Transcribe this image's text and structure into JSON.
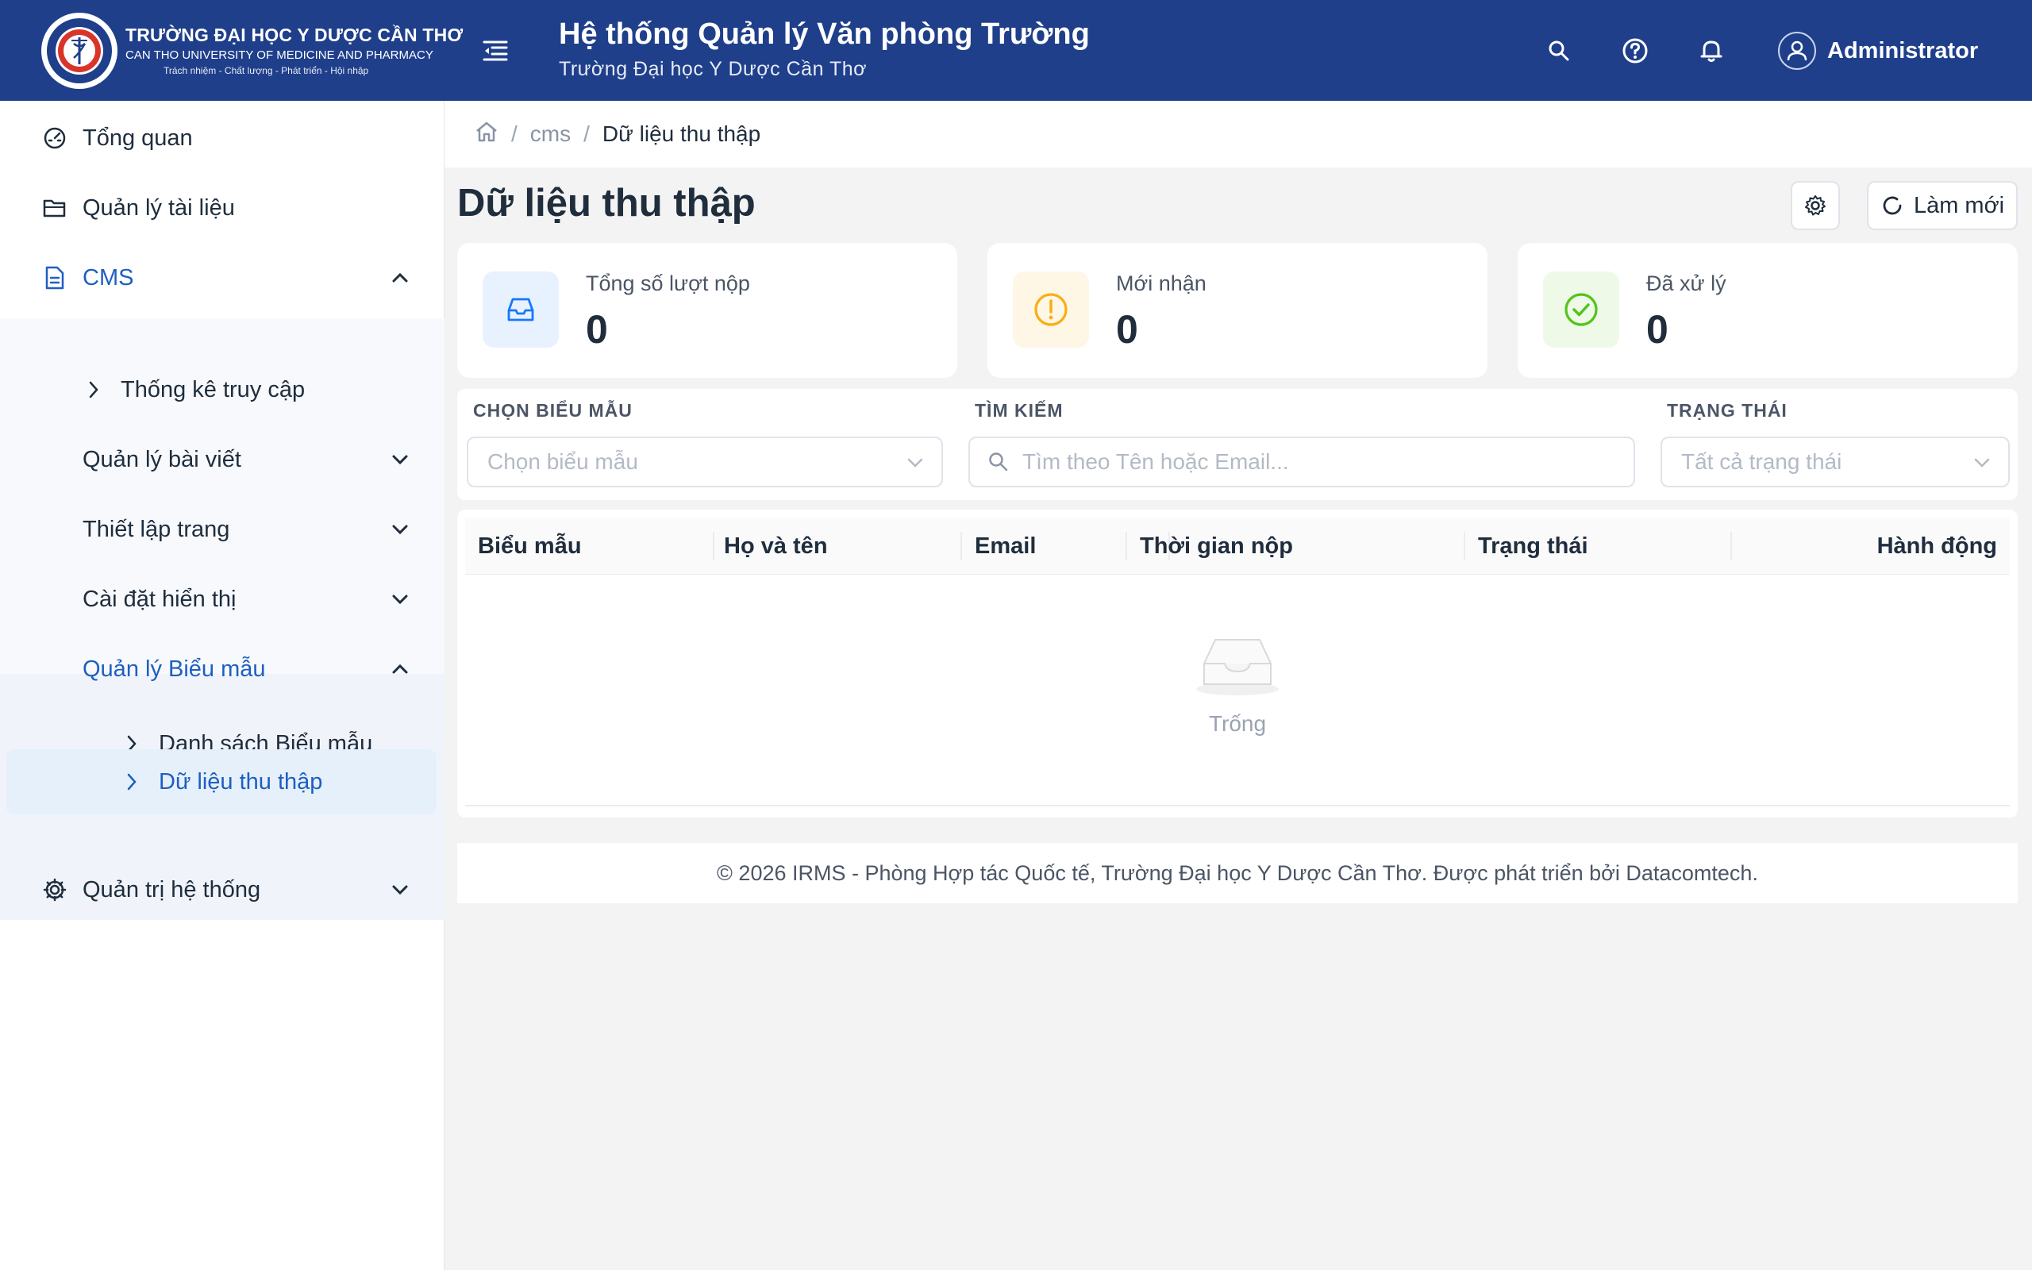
{
  "header": {
    "logo": {
      "line1": "TRƯỜNG ĐẠI HỌC Y DƯỢC CẦN THƠ",
      "line2": "CAN THO UNIVERSITY OF MEDICINE AND PHARMACY",
      "line3": "Trách nhiệm - Chất lượng - Phát triển - Hội nhập"
    },
    "title": "Hệ thống Quản lý Văn phòng Trường",
    "subtitle": "Trường Đại học Y Dược Cần Thơ",
    "icons": [
      "search-icon",
      "help-icon",
      "bell-icon"
    ],
    "user": "Administrator",
    "color": "#1f3f8b"
  },
  "sidebar": {
    "items": [
      {
        "label": "Tổng quan",
        "icon": "dashboard-icon"
      },
      {
        "label": "Quản lý tài liệu",
        "icon": "folder-icon"
      },
      {
        "label": "CMS",
        "icon": "document-icon",
        "expanded": true
      },
      {
        "label": "Quản trị hệ thống",
        "icon": "gear-icon"
      }
    ],
    "cms_children": [
      {
        "label": "Thống kê truy cập"
      },
      {
        "label": "Quản lý bài viết"
      },
      {
        "label": "Thiết lập trang"
      },
      {
        "label": "Cài đặt hiển thị"
      },
      {
        "label": "Quản lý Biểu mẫu",
        "expanded": true
      }
    ],
    "form_children": [
      {
        "label": "Danh sách Biểu mẫu"
      },
      {
        "label": "Dữ liệu thu thập",
        "selected": true
      }
    ],
    "active_color": "#1e5fc2"
  },
  "breadcrumb": {
    "items": [
      "cms",
      "Dữ liệu thu thập"
    ]
  },
  "page": {
    "title": "Dữ liệu thu thập",
    "refresh_label": "Làm mới"
  },
  "stats": [
    {
      "label": "Tổng số lượt nộp",
      "value": "0",
      "icon": "inbox-icon",
      "color": "#1677ff"
    },
    {
      "label": "Mới nhận",
      "value": "0",
      "icon": "exclamation-icon",
      "color": "#faad14"
    },
    {
      "label": "Đã xử lý",
      "value": "0",
      "icon": "check-circle-icon",
      "color": "#52c41a"
    }
  ],
  "filters": {
    "form": {
      "label": "CHỌN BIỂU MẪU",
      "placeholder": "Chọn biểu mẫu"
    },
    "search": {
      "label": "TÌM KIẾM",
      "placeholder": "Tìm theo Tên hoặc Email..."
    },
    "status": {
      "label": "TRẠNG THÁI",
      "placeholder": "Tất cả trạng thái"
    }
  },
  "table": {
    "columns": [
      "Biểu mẫu",
      "Họ và tên",
      "Email",
      "Thời gian nộp",
      "Trạng thái",
      "Hành động"
    ],
    "rows": [],
    "empty_text": "Trống"
  },
  "footer": {
    "text": "© 2026 IRMS - Phòng Hợp tác Quốc tế, Trường Đại học Y Dược Cần Thơ. Được phát triển bởi Datacomtech."
  }
}
